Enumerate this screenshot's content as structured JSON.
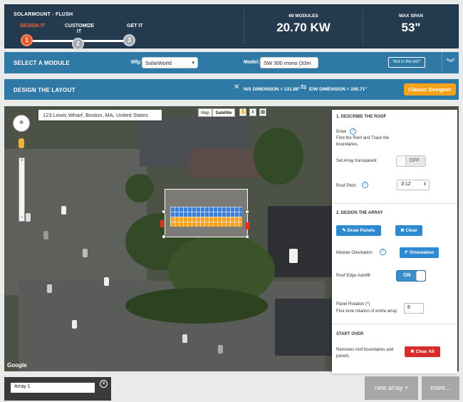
{
  "header": {
    "product": "SOLARMOUNT - FLUSH",
    "steps": [
      {
        "label": "DESIGN IT",
        "number": "1"
      },
      {
        "label": "CUSTOMIZE IT",
        "number": "2"
      },
      {
        "label": "GET IT",
        "number": "3"
      }
    ],
    "modules_label": "69 MODULES",
    "modules_value": "20.70 KW",
    "span_label": "MAX SPAN",
    "span_value": "53\""
  },
  "module_bar": {
    "title": "SELECT A MODULE",
    "mfg_label": "Mfg:",
    "mfg_value": "SolarWorld",
    "model_label": "Model:",
    "model_value": "SW 300 mono (33m",
    "not_listed": "Not in the list?"
  },
  "layout_bar": {
    "title": "DESIGN THE LAYOUT",
    "ns_dimension": "N/S DIMENSION = 131.88\"",
    "ew_dimension": "E/W DIMENSION = 240.71\"",
    "classic_button": "Classic Designer"
  },
  "map": {
    "address": "123 Lewis Wharf, Boston, MA, United States",
    "type_map": "Map",
    "type_satellite": "Satellite",
    "logo": "Google"
  },
  "panel": {
    "section1_title": "1. DESCRIBE THE ROOF",
    "draw_label": "Draw",
    "draw_help": "Find the Roof and Trace the boundaries.",
    "transparent_label": "Set Array transparent",
    "transparent_value": "OFF",
    "pitch_label": "Roof Pitch",
    "pitch_value": "3:12",
    "section2_title": "2. DESIGN THE ARRAY",
    "draw_panels": "Draw Panels",
    "clear": "Clear",
    "orientation_label": "Module Orientation",
    "orientation_button": "Orientation",
    "autofill_label": "Roof Edge Autofill",
    "autofill_value": "ON",
    "rotation_label": "Panel Rotation (*)",
    "rotation_help": "Fine tune rotation of entire array",
    "rotation_value": "8",
    "startover_title": "START OVER",
    "startover_text": "Removes roof boundaries and panels.",
    "clear_all": "Clear All"
  },
  "bottom": {
    "array_name": "Array 1",
    "new_array": "new array +",
    "more": "more..."
  }
}
